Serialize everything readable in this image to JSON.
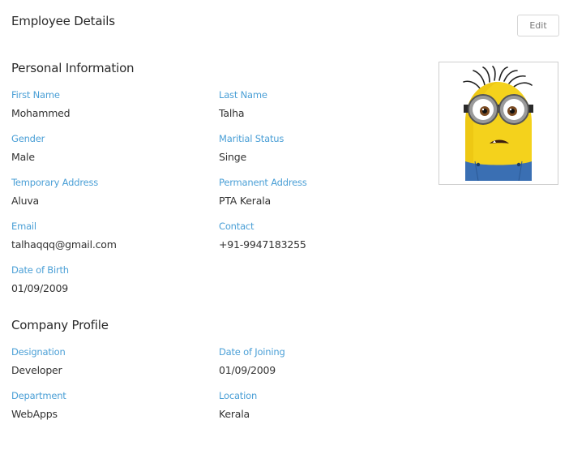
{
  "header": {
    "title": "Employee Details",
    "edit_label": "Edit"
  },
  "personal": {
    "title": "Personal Information",
    "first_name": {
      "label": "First Name",
      "value": "Mohammed"
    },
    "last_name": {
      "label": "Last Name",
      "value": "Talha"
    },
    "gender": {
      "label": "Gender",
      "value": "Male"
    },
    "marital_status": {
      "label": "Maritial Status",
      "value": "Singe"
    },
    "temporary_address": {
      "label": "Temporary Address",
      "value": "Aluva"
    },
    "permanent_address": {
      "label": "Permanent Address",
      "value": "PTA Kerala"
    },
    "email": {
      "label": "Email",
      "value": "talhaqqq@gmail.com"
    },
    "contact": {
      "label": "Contact",
      "value": "+91-9947183255"
    },
    "dob": {
      "label": "Date of Birth",
      "value": "01/09/2009"
    }
  },
  "company": {
    "title": "Company Profile",
    "designation": {
      "label": "Designation",
      "value": "Developer"
    },
    "date_of_joining": {
      "label": "Date of Joining",
      "value": "01/09/2009"
    },
    "department": {
      "label": "Department",
      "value": "WebApps"
    },
    "location": {
      "label": "Location",
      "value": "Kerala"
    }
  },
  "colors": {
    "label": "#4a9fd6",
    "text": "#333333",
    "heading": "#2b2b2b"
  },
  "profile_photo": {
    "icon": "minion-avatar"
  }
}
